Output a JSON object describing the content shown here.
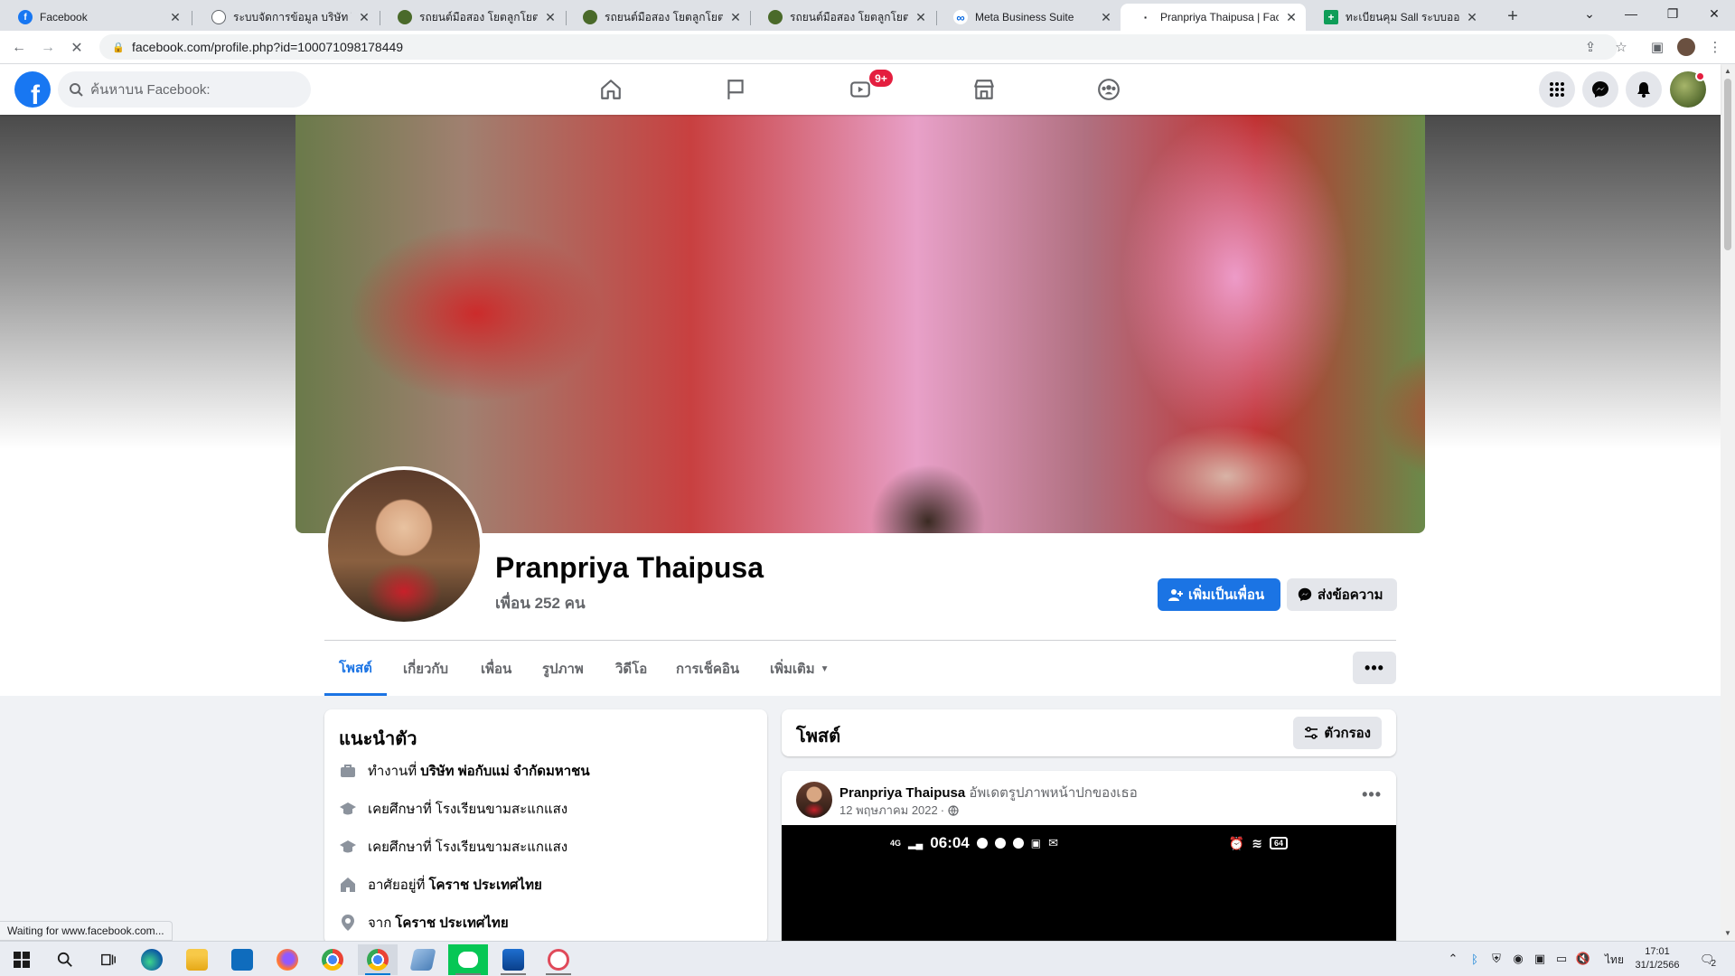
{
  "browser": {
    "tabs": [
      {
        "title": "Facebook",
        "icon": "facebook-icon",
        "color": "#1877f2",
        "active": false
      },
      {
        "title": "ระบบจัดการข้อมูล บริษัท โยตลู...",
        "icon": "globe-icon",
        "color": "#5f6368",
        "active": false
      },
      {
        "title": "รถยนต์มือสอง โยตลูกโยต อุดร...",
        "icon": "car-dealer-icon",
        "color": "#4a6a2a",
        "active": false
      },
      {
        "title": "รถยนต์มือสอง โยตลูกโยต อุดร...",
        "icon": "car-dealer-icon",
        "color": "#4a6a2a",
        "active": false
      },
      {
        "title": "รถยนต์มือสอง โยตลูกโยต อุดร...",
        "icon": "car-dealer-icon",
        "color": "#4a6a2a",
        "active": false
      },
      {
        "title": "Meta Business Suite",
        "icon": "meta-icon",
        "color": "#0668e1",
        "active": false
      },
      {
        "title": "Pranpriya Thaipusa | Faceb",
        "icon": "loading-dot-icon",
        "color": "#202124",
        "active": true
      },
      {
        "title": "ทะเบียนคุม Sall ระบบออนไลน์",
        "icon": "sheets-icon",
        "color": "#0f9d58",
        "active": false
      }
    ],
    "url": "facebook.com/profile.php?id=100071098178449",
    "status_text": "Waiting for www.facebook.com..."
  },
  "fb": {
    "search_placeholder": "ค้นหาบน Facebook:",
    "video_badge": "9+",
    "profile": {
      "name": "Pranpriya Thaipusa",
      "friends": "เพื่อน 252 คน",
      "add_friend_label": "เพิ่มเป็นเพื่อน",
      "message_label": "ส่งข้อความ"
    },
    "tabs": [
      {
        "label": "โพสต์",
        "active": true
      },
      {
        "label": "เกี่ยวกับ",
        "active": false
      },
      {
        "label": "เพื่อน",
        "active": false
      },
      {
        "label": "รูปภาพ",
        "active": false
      },
      {
        "label": "วิดีโอ",
        "active": false
      },
      {
        "label": "การเช็คอิน",
        "active": false
      },
      {
        "label": "เพิ่มเติม",
        "active": false
      }
    ],
    "intro": {
      "title": "แนะนำตัว",
      "rows": [
        {
          "icon": "briefcase-icon",
          "prefix": "ทำงานที่",
          "value": "บริษัท พ่อกับแม่ จำกัดมหาชน"
        },
        {
          "icon": "graduation-cap-icon",
          "prefix": "เคยศึกษาที่",
          "value": "โรงเรียนขามสะแกแสง"
        },
        {
          "icon": "graduation-cap-icon",
          "prefix": "เคยศึกษาที่",
          "value": "โรงเรียนขามสะแกแสง"
        },
        {
          "icon": "home-icon",
          "prefix": "อาศัยอยู่ที่",
          "value": "โคราช ประเทศไทย"
        },
        {
          "icon": "location-pin-icon",
          "prefix": "จาก",
          "value": "โคราช ประเทศไทย"
        }
      ]
    },
    "posts": {
      "title": "โพสต์",
      "filter_label": "ตัวกรอง",
      "post": {
        "author": "Pranpriya Thaipusa",
        "action": "อัพเดตรูปภาพหน้าปกของเธอ",
        "date": "12 พฤษภาคม 2022",
        "phone_time": "06:04",
        "phone_network": "4G",
        "phone_battery": "64"
      }
    }
  },
  "taskbar": {
    "lang": "ไทย",
    "time": "17:01",
    "date": "31/1/2566",
    "notif_count": "2"
  },
  "colors": {
    "fb_blue": "#1877f2",
    "button_blue": "#1b74e4",
    "badge_red": "#e41e3f"
  }
}
